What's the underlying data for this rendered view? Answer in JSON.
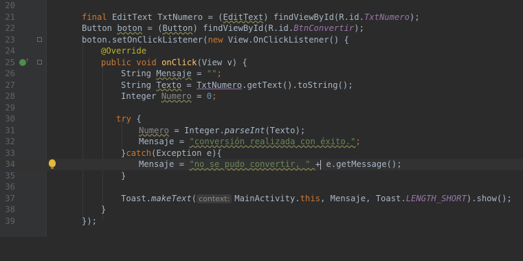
{
  "editor": {
    "lines": [
      {
        "num": "20"
      },
      {
        "num": "21"
      },
      {
        "num": "22"
      },
      {
        "num": "23"
      },
      {
        "num": "24"
      },
      {
        "num": "25"
      },
      {
        "num": "26"
      },
      {
        "num": "27"
      },
      {
        "num": "28"
      },
      {
        "num": "29"
      },
      {
        "num": "30"
      },
      {
        "num": "31"
      },
      {
        "num": "32"
      },
      {
        "num": "33"
      },
      {
        "num": "34"
      },
      {
        "num": "35"
      },
      {
        "num": "36"
      },
      {
        "num": "37"
      },
      {
        "num": "38"
      },
      {
        "num": "39"
      }
    ],
    "tokens": {
      "l21": [
        "final ",
        "EditText ",
        "TxtNumero",
        " = (",
        "EditText",
        ") findViewById(R.id.",
        "TxtNumero",
        ");"
      ],
      "l22": [
        "Button ",
        "boton",
        " = (",
        "Button",
        ") findViewById(R.id.",
        "BtnConvertir",
        ");"
      ],
      "l23": [
        "boton.setOnClickListener(",
        "new ",
        "View.OnClickListener() {"
      ],
      "l24": [
        "@Override"
      ],
      "l25": [
        "public ",
        "void ",
        "onClick",
        "(View v) {"
      ],
      "l26": [
        "String ",
        "Mensaje",
        " = ",
        "\"\"",
        ";"
      ],
      "l27": [
        "String ",
        "Texto",
        " = ",
        "TxtNumero",
        ".getText().toString();"
      ],
      "l28": [
        "Integer ",
        "Numero",
        " = ",
        "0",
        ";"
      ],
      "l30": [
        "try ",
        "{"
      ],
      "l31": [
        "Numero",
        " = Integer.",
        "parseInt",
        "(Texto);"
      ],
      "l32": [
        "Mensaje = ",
        "\"conversión realizada con éxito.\"",
        ";"
      ],
      "l33": [
        "}",
        "catch",
        "(Exception e){"
      ],
      "l34": [
        "Mensaje = ",
        "\"no se pudo convertir, \" ",
        "+",
        " e.getMessage();"
      ],
      "l35": [
        "}"
      ],
      "l37": [
        "Toast.",
        "makeText",
        "(",
        "context:",
        "MainActivity.",
        "this",
        ", Mensaje, Toast.",
        "LENGTH_SHORT",
        ").show();"
      ],
      "l38": [
        "}"
      ],
      "l39": [
        "});"
      ]
    }
  }
}
